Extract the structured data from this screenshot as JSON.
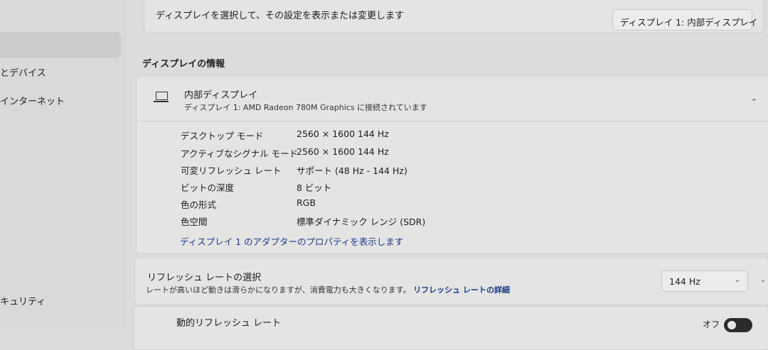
{
  "sidebar": {
    "items": [
      {
        "label": "とデバイス"
      },
      {
        "label": "インターネット"
      },
      {
        "label": "キュリティ"
      }
    ]
  },
  "select_display": {
    "description": "ディスプレイを選択して、その設定を表示または変更します",
    "value": "ディスプレイ 1: 内部ディスプレイ"
  },
  "display_info": {
    "section_title": "ディスプレイの情報",
    "name": "内部ディスプレイ",
    "subtitle": "ディスプレイ 1: AMD Radeon 780M Graphics に接続されています",
    "rows": [
      {
        "label": "デスクトップ モード",
        "value": "2560 × 1600 144 Hz"
      },
      {
        "label": "アクティブなシグナル モード",
        "value": "2560 × 1600 144 Hz"
      },
      {
        "label": "可変リフレッシュ レート",
        "value": "サポート (48 Hz - 144 Hz)"
      },
      {
        "label": "ビットの深度",
        "value": "8 ビット"
      },
      {
        "label": "色の形式",
        "value": "RGB"
      },
      {
        "label": "色空間",
        "value": "標準ダイナミック レンジ (SDR)"
      }
    ],
    "adapter_link": "ディスプレイ 1 のアダプターのプロパティを表示します"
  },
  "refresh_rate": {
    "title": "リフレッシュ レートの選択",
    "description": "レートが高いほど動きは滑らかになりますが、消費電力も大きくなります。",
    "details_link": "リフレッシュ レートの詳細",
    "value": "144 Hz"
  },
  "dynamic_refresh": {
    "title": "動的リフレッシュ レート",
    "state_label": "オフ"
  }
}
